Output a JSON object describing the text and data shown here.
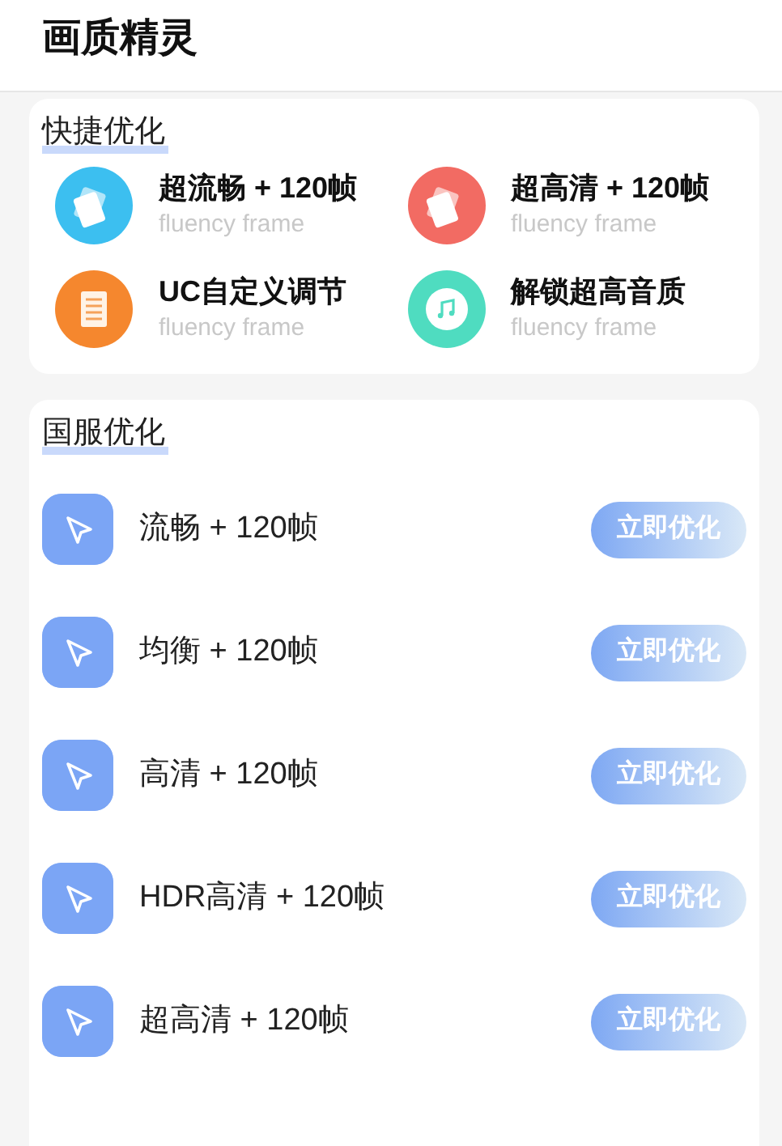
{
  "header": {
    "title": "画质精灵"
  },
  "quick": {
    "title": "快捷优化",
    "items": [
      {
        "title": "超流畅 + 120帧",
        "subtitle": "fluency frame",
        "kind": "cards",
        "color": "#3cbff0"
      },
      {
        "title": "超高清 + 120帧",
        "subtitle": "fluency frame",
        "kind": "cards",
        "color": "#f26b63"
      },
      {
        "title": "UC自定义调节",
        "subtitle": "fluency frame",
        "kind": "document",
        "color": "#f5872e"
      },
      {
        "title": "解锁超高音质",
        "subtitle": "fluency frame",
        "kind": "music",
        "color": "#4fdcc0"
      }
    ]
  },
  "server": {
    "title": "国服优化",
    "items": [
      {
        "label": "流畅 + 120帧",
        "button": "立即优化"
      },
      {
        "label": "均衡 + 120帧",
        "button": "立即优化"
      },
      {
        "label": "高清 + 120帧",
        "button": "立即优化"
      },
      {
        "label": "HDR高清 + 120帧",
        "button": "立即优化"
      },
      {
        "label": "超高清 + 120帧",
        "button": "立即优化"
      }
    ]
  }
}
